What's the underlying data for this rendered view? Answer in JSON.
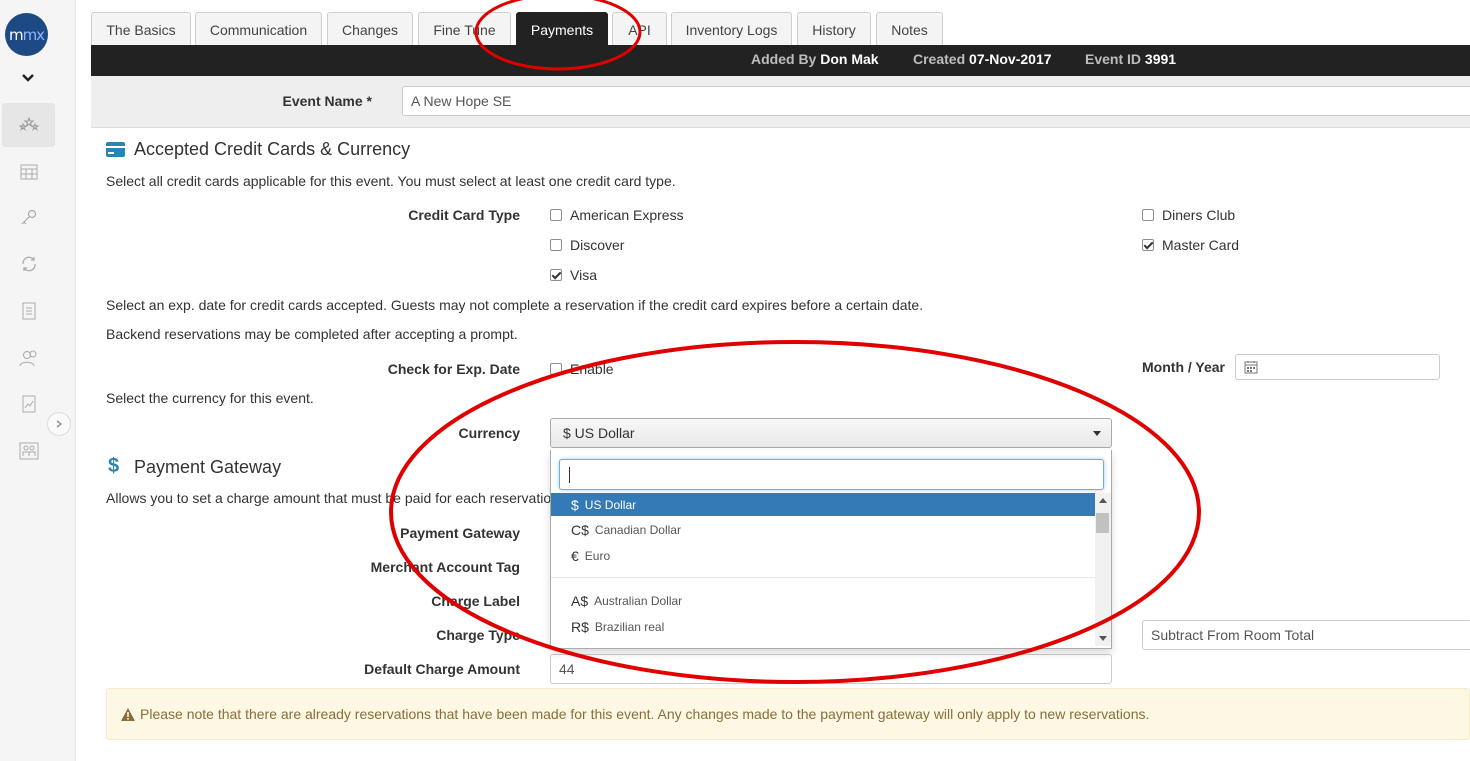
{
  "sidebar": {
    "logo_text_a": "m",
    "logo_text_b": "mx",
    "icons": [
      "collapse-chevron-icon",
      "stars-icon",
      "calendar-grid-icon",
      "key-icon",
      "sync-icon",
      "document-list-icon",
      "users-icon",
      "chart-doc-icon",
      "group-icon"
    ]
  },
  "tabs": [
    "The Basics",
    "Communication",
    "Changes",
    "Fine Tune",
    "Payments",
    "API",
    "Inventory Logs",
    "History",
    "Notes"
  ],
  "active_tab": "Payments",
  "infobar": {
    "added_by_label": "Added By",
    "added_by_value": "Don Mak",
    "created_label": "Created",
    "created_value": "07-Nov-2017",
    "event_id_label": "Event ID",
    "event_id_value": "3991"
  },
  "event_name": {
    "label": "Event Name *",
    "value": "A New Hope SE"
  },
  "credit_cards": {
    "title": "Accepted Credit Cards & Currency",
    "help": "Select all credit cards applicable for this event. You must select at least one credit card type.",
    "type_label": "Credit Card Type",
    "options": [
      {
        "label": "American Express",
        "checked": false
      },
      {
        "label": "Discover",
        "checked": false
      },
      {
        "label": "Visa",
        "checked": true
      },
      {
        "label": "Diners Club",
        "checked": false
      },
      {
        "label": "Master Card",
        "checked": true
      }
    ],
    "exp_help_1": "Select an exp. date for credit cards accepted. Guests may not complete a reservation if the credit card expires before a certain date.",
    "exp_help_2": "Backend reservations may be completed after accepting a prompt.",
    "exp_label": "Check for Exp. Date",
    "exp_enable": "Enable",
    "month_year_label": "Month / Year",
    "month_year_value": "",
    "currency_help": "Select the currency for this event.",
    "currency_label": "Currency",
    "currency_value": "$ US Dollar"
  },
  "currency_dropdown": {
    "search_value": "",
    "options": [
      {
        "symbol": "$",
        "name": "US Dollar",
        "selected": true
      },
      {
        "symbol": "C$",
        "name": "Canadian Dollar",
        "selected": false
      },
      {
        "symbol": "€",
        "name": "Euro",
        "selected": false
      },
      {
        "symbol": "A$",
        "name": "Australian Dollar",
        "selected": false
      },
      {
        "symbol": "R$",
        "name": "Brazilian real",
        "selected": false
      }
    ]
  },
  "payment_gateway": {
    "title": "Payment Gateway",
    "help": "Allows you to set a charge amount that must be paid for each reservation",
    "gateway_label": "Payment Gateway",
    "merchant_label": "Merchant Account Tag",
    "charge_label_label": "Charge Label",
    "charge_type_label": "Charge Type",
    "charge_type_value": "Subtract From Room Total",
    "default_amount_label": "Default Charge Amount",
    "default_amount_value": "44"
  },
  "alert": {
    "text": "Please note that there are already reservations that have been made for this event. Any changes made to the payment gateway will only apply to new reservations."
  },
  "colors": {
    "annotation_red": "#e00000",
    "selected_blue": "#337ab7",
    "dark_bar": "#222222",
    "accent_teal": "#2a84b8"
  }
}
